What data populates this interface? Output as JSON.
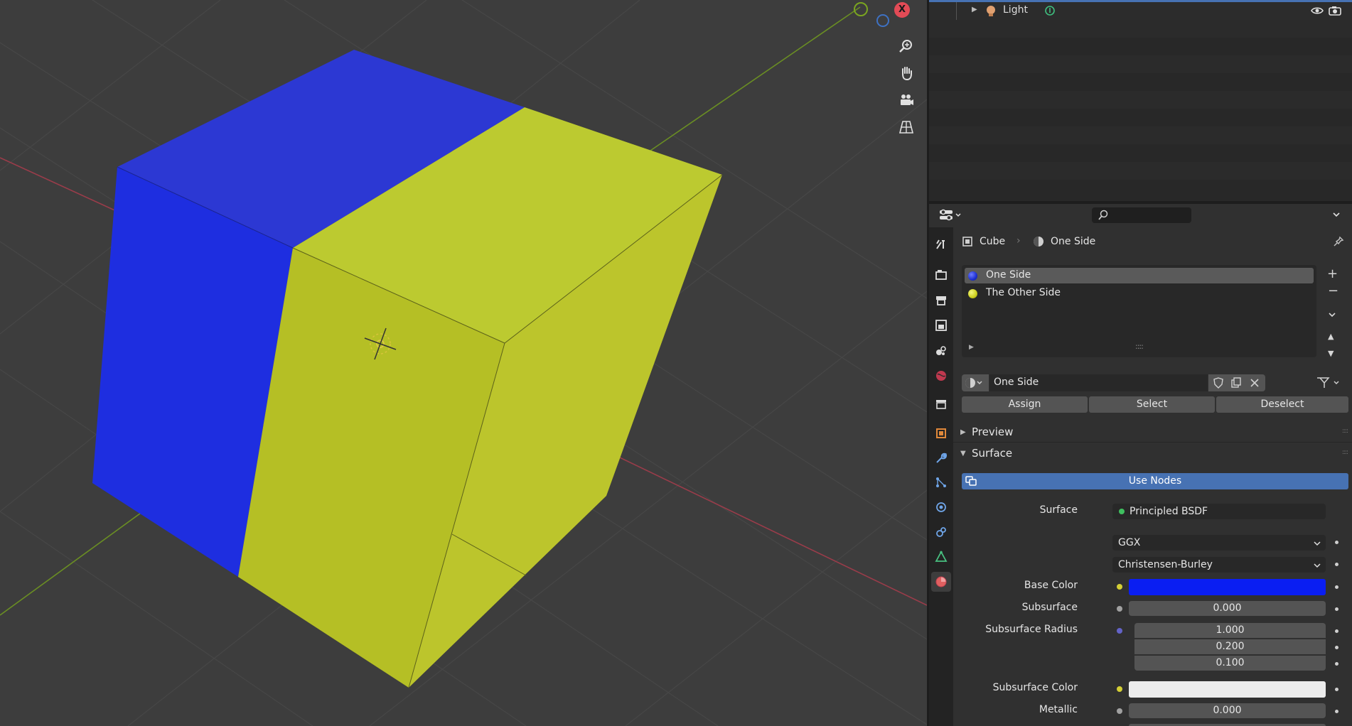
{
  "outliner": {
    "light_label": "Light"
  },
  "properties": {
    "breadcrumb": {
      "object": "Cube",
      "material": "One Side"
    },
    "material_slots": [
      {
        "name": "One Side",
        "color": "#1c2fd1",
        "selected": true
      },
      {
        "name": "The Other Side",
        "color": "#cdd11e",
        "selected": false
      }
    ],
    "material_name": "One Side",
    "assign_label": "Assign",
    "select_label": "Select",
    "deselect_label": "Deselect",
    "preview_label": "Preview",
    "surface_panel_label": "Surface",
    "use_nodes_label": "Use Nodes",
    "surface_label": "Surface",
    "surface_shader": "Principled BSDF",
    "distribution": "GGX",
    "subsurface_method": "Christensen-Burley",
    "base_color_label": "Base Color",
    "base_color": "#0a1ef2",
    "subsurface_label": "Subsurface",
    "subsurface_value": "0.000",
    "subsurface_radius_label": "Subsurface Radius",
    "subsurface_radius": [
      "1.000",
      "0.200",
      "0.100"
    ],
    "subsurface_color_label": "Subsurface Color",
    "subsurface_color": "#ececec",
    "metallic_label": "Metallic",
    "metallic_value": "0.000"
  },
  "viewport": {
    "face_blue": "#2c39d4",
    "face_yellow": "#c6cd30",
    "gizmo_x_label": "X"
  },
  "colors": {
    "accent": "#4772b3"
  }
}
